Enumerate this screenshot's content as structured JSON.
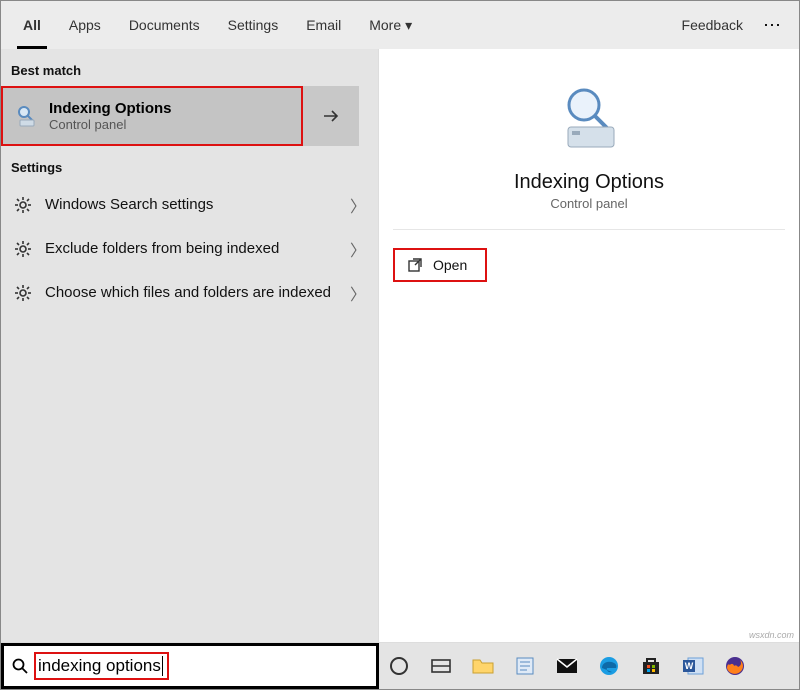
{
  "tabs": {
    "items": [
      {
        "label": "All",
        "active": true
      },
      {
        "label": "Apps",
        "active": false
      },
      {
        "label": "Documents",
        "active": false
      },
      {
        "label": "Settings",
        "active": false
      },
      {
        "label": "Email",
        "active": false
      },
      {
        "label": "More",
        "active": false,
        "dropdown": true
      }
    ],
    "feedback_label": "Feedback",
    "more_menu_icon": "more-dots"
  },
  "left": {
    "best_match_label": "Best match",
    "best_match": {
      "title": "Indexing Options",
      "subtitle": "Control panel",
      "icon": "indexing-options-icon",
      "forward_icon": "arrow-right-icon"
    },
    "settings_label": "Settings",
    "settings": [
      {
        "label": "Windows Search settings"
      },
      {
        "label": "Exclude folders from being indexed"
      },
      {
        "label": "Choose which files and folders are indexed"
      }
    ]
  },
  "right": {
    "title": "Indexing Options",
    "subtitle": "Control panel",
    "open_label": "Open"
  },
  "search": {
    "query": "indexing options"
  },
  "taskbar_icons": [
    "cortana-ring-icon",
    "task-view-icon",
    "file-explorer-icon",
    "notepad-icon",
    "mail-icon",
    "edge-icon",
    "microsoft-store-icon",
    "word-icon",
    "firefox-icon"
  ],
  "watermark": "wsxdn.com"
}
